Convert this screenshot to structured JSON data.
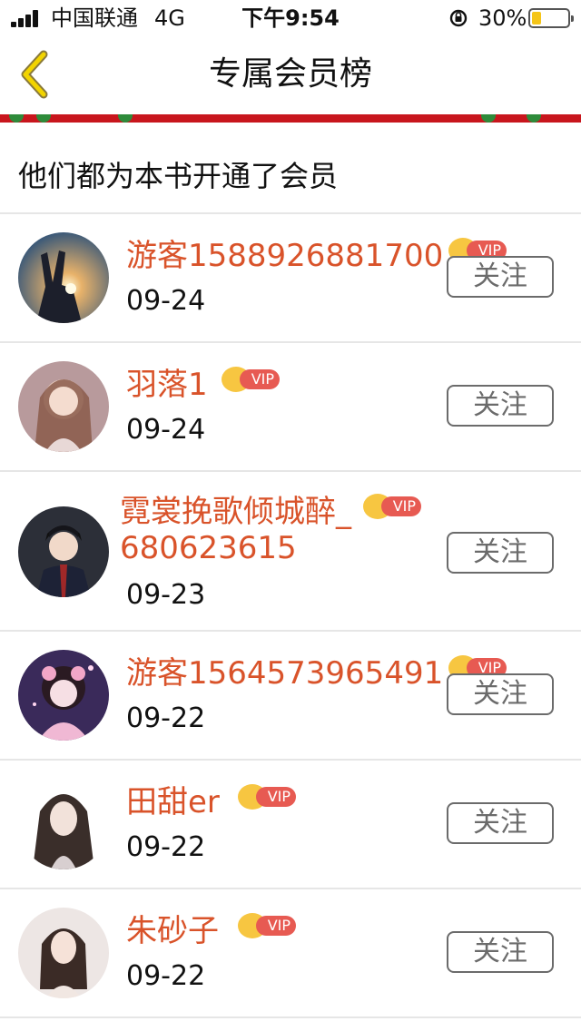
{
  "status_bar": {
    "carrier": "中国联通",
    "network": "4G",
    "time": "下午9:54",
    "battery_percent": "30%",
    "battery_level": 0.3,
    "icons": [
      "signal-icon",
      "rotation-lock-icon",
      "battery-icon"
    ]
  },
  "nav": {
    "back_icon": "chevron-left-icon",
    "title": "专属会员榜"
  },
  "section_title": "他们都为本书开通了会员",
  "vip_label": "VIP",
  "colors": {
    "name_accent": "#d9532a",
    "vip_tag": "#e75a52",
    "crown": "#f7c641",
    "banner": "#c8161d",
    "back_icon": "#f2c200"
  },
  "members": [
    {
      "name": "游客1588926881700",
      "date": "09-24",
      "follow_label": "关注"
    },
    {
      "name": "羽落1",
      "date": "09-24",
      "follow_label": "关注"
    },
    {
      "name": "霓裳挽歌倾城醉_680623615",
      "date": "09-23",
      "follow_label": "关注"
    },
    {
      "name": "游客1564573965491",
      "date": "09-22",
      "follow_label": "关注"
    },
    {
      "name": "田甜er",
      "date": "09-22",
      "follow_label": "关注"
    },
    {
      "name": "朱砂子",
      "date": "09-22",
      "follow_label": "关注"
    }
  ]
}
